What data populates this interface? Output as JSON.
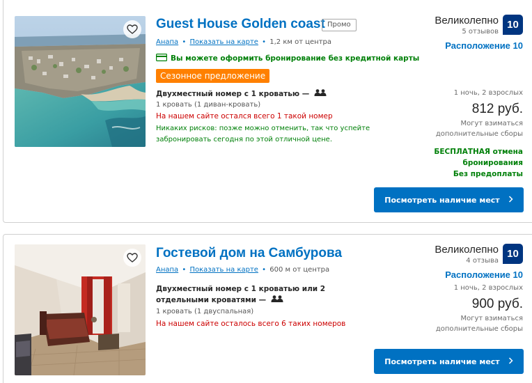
{
  "listings": [
    {
      "title": "Guest House Golden coast",
      "badge": "Промо",
      "city": "Анапа",
      "map_link": "Показать на карте",
      "distance": "1,2 км от центра",
      "no_card": "Вы можете оформить бронирование без кредитной карты",
      "seasonal": "Сезонное предложение",
      "room_type": "Двухместный номер с 1 кроватью —",
      "bed": "1 кровать (1 диван-кровать)",
      "rooms_left": "На нашем сайте остался всего 1 такой номер",
      "no_risk": "Никаких рисков: позже можно отменить, так что успейте забронировать сегодня по этой отличной цене.",
      "rating_word": "Великолепно",
      "review_count": "5 отзывов",
      "score": "10",
      "location_score": "Расположение 10",
      "nights": "1 ночь, 2 взрослых",
      "price": "812 руб.",
      "fees": "Могут взиматься дополнительные сборы",
      "free_cancel": "БЕСПЛАТНАЯ отмена бронирования",
      "no_prepay": "Без предоплаты",
      "cta": "Посмотреть наличие мест"
    },
    {
      "title": "Гостевой дом на Самбурова",
      "city": "Анапа",
      "map_link": "Показать на карте",
      "distance": "600 м от центра",
      "room_type": "Двухместный номер с 1 кроватью или 2 отдельными кроватями —",
      "bed": "1 кровать (1 двуспальная)",
      "rooms_left": "На нашем сайте осталось всего 6 таких номеров",
      "rating_word": "Великолепно",
      "review_count": "4 отзыва",
      "score": "10",
      "location_score": "Расположение 10",
      "nights": "1 ночь, 2 взрослых",
      "price": "900 руб.",
      "fees": "Могут взиматься дополнительные сборы",
      "cta": "Посмотреть наличие мест"
    }
  ],
  "colors": {
    "link_blue": "#0071c2",
    "score_navy": "#003580",
    "green": "#008009",
    "red": "#cc0000",
    "orange": "#ff8000"
  },
  "icons": [
    "heart-icon",
    "credit-card-icon",
    "people-icon",
    "chevron-right-icon"
  ]
}
